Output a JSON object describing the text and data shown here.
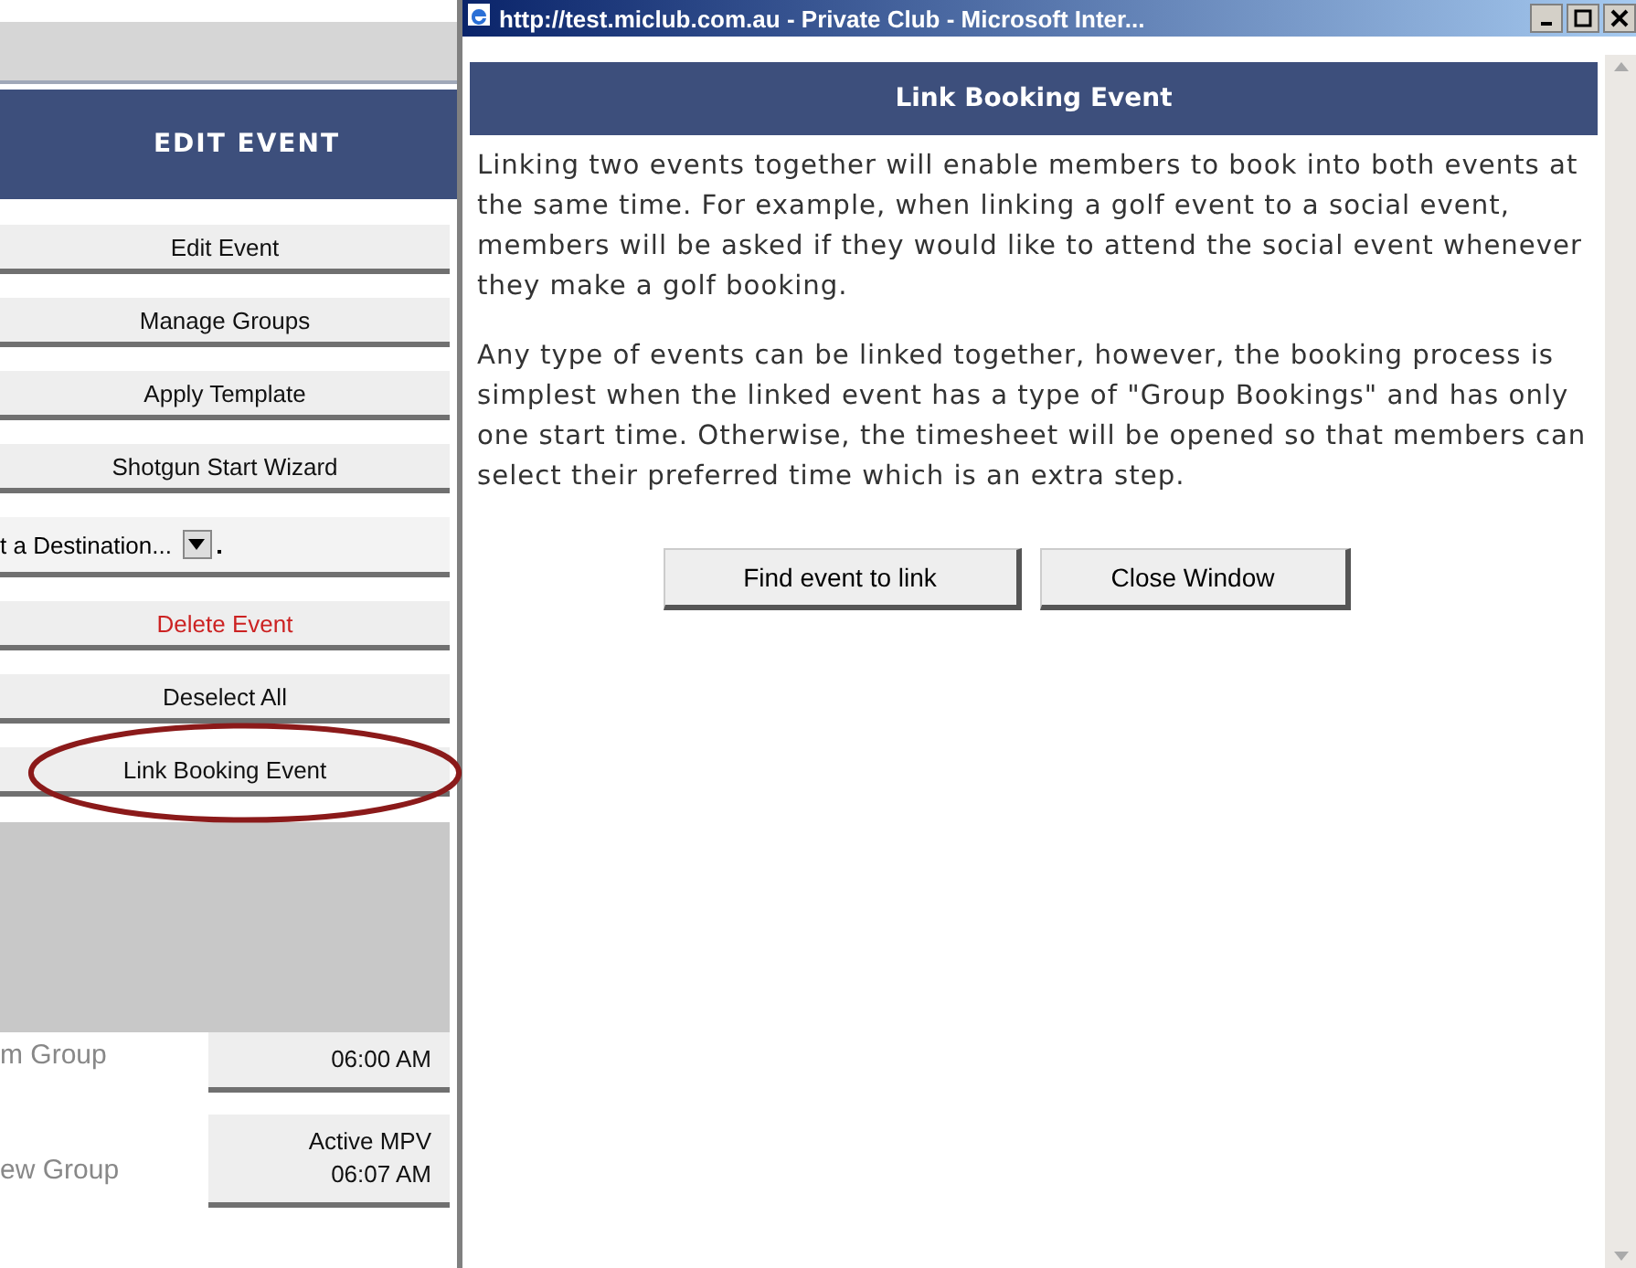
{
  "left_panel": {
    "title": "EDIT EVENT",
    "actions": [
      {
        "kind": "button",
        "label": "Edit Event",
        "danger": false,
        "highlighted": false
      },
      {
        "kind": "button",
        "label": "Manage Groups",
        "danger": false,
        "highlighted": false
      },
      {
        "kind": "button",
        "label": "Apply Template",
        "danger": false,
        "highlighted": false
      },
      {
        "kind": "button",
        "label": "Shotgun Start Wizard",
        "danger": false,
        "highlighted": false
      },
      {
        "kind": "select",
        "value": "t a Destination..."
      },
      {
        "kind": "button",
        "label": "Delete Event",
        "danger": true,
        "highlighted": false
      },
      {
        "kind": "button",
        "label": "Deselect All",
        "danger": false,
        "highlighted": false
      },
      {
        "kind": "button",
        "label": "Link Booking Event",
        "danger": false,
        "highlighted": true
      }
    ],
    "groups": [
      {
        "name": "m Group",
        "time": "06:00 AM"
      },
      {
        "name": "ew Group",
        "status": "Active MPV",
        "time": "06:07 AM"
      }
    ]
  },
  "popup": {
    "title": "http://test.miclub.com.au - Private Club - Microsoft Inter...",
    "header": "Link Booking Event",
    "paragraphs": [
      "Linking two events together will enable members to book into both events at the same time. For example, when linking a golf event to a social event, members will be asked if they would like to attend the social event whenever they make a golf booking.",
      "Any type of events can be linked together, however, the booking process is simplest when the linked event has a type of \"Group Bookings\" and has only one start time. Otherwise, the timesheet will be opened so that members can select their preferred time which is an extra step."
    ],
    "buttons": [
      "Find event to link",
      "Close Window"
    ]
  }
}
